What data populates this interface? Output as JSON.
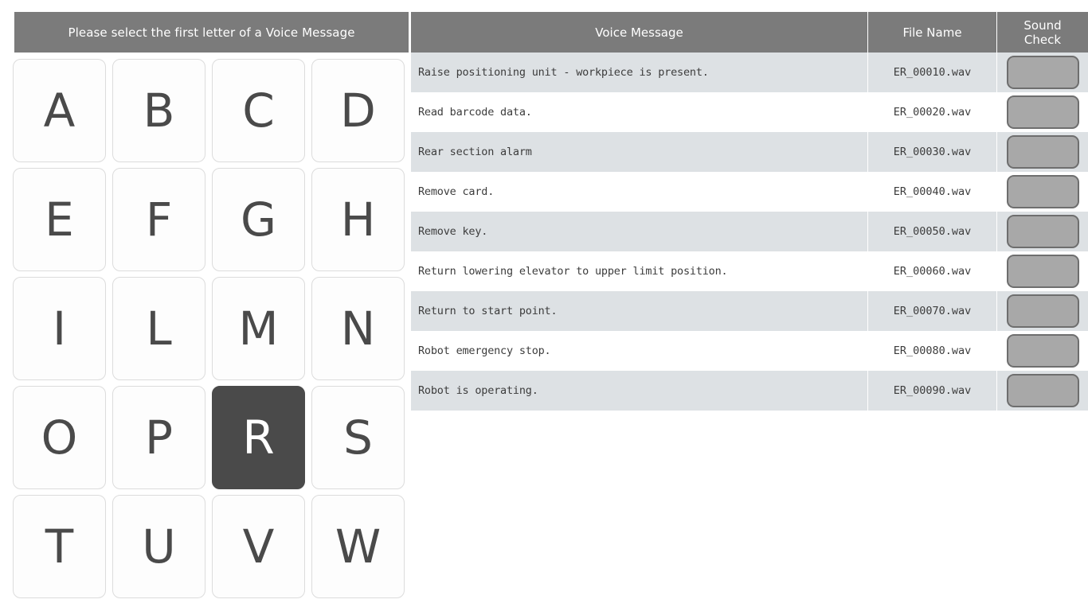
{
  "letter_panel": {
    "header_label": "Please select the first letter of a Voice Message",
    "selected_letter": "R",
    "letters": [
      "A",
      "B",
      "C",
      "D",
      "E",
      "F",
      "G",
      "H",
      "I",
      "L",
      "M",
      "N",
      "O",
      "P",
      "R",
      "S",
      "T",
      "U",
      "V",
      "W"
    ]
  },
  "table": {
    "columns": {
      "message": "Voice Message",
      "filename": "File Name",
      "sound_check_line1": "Sound",
      "sound_check_line2": "Check"
    },
    "sound_check_button_name": "play-sound-button",
    "rows": [
      {
        "message": "Raise positioning unit - workpiece is present.",
        "filename": "ER_00010.wav"
      },
      {
        "message": "Read barcode data.",
        "filename": "ER_00020.wav"
      },
      {
        "message": "Rear section alarm",
        "filename": "ER_00030.wav"
      },
      {
        "message": "Remove card.",
        "filename": "ER_00040.wav"
      },
      {
        "message": "Remove key.",
        "filename": "ER_00050.wav"
      },
      {
        "message": "Return lowering elevator to upper limit position.",
        "filename": "ER_00060.wav"
      },
      {
        "message": "Return to start point.",
        "filename": "ER_00070.wav"
      },
      {
        "message": "Robot emergency stop.",
        "filename": "ER_00080.wav"
      },
      {
        "message": "Robot is operating.",
        "filename": "ER_00090.wav"
      }
    ]
  },
  "colors": {
    "header_bar": "#7b7b7b",
    "selected_key_bg": "#4a4a4a",
    "row_alt_bg": "#dde1e4",
    "key_text": "#4a4a4a",
    "sound_button_bg": "#a8a8a8",
    "sound_button_border": "#6e6e6e"
  }
}
